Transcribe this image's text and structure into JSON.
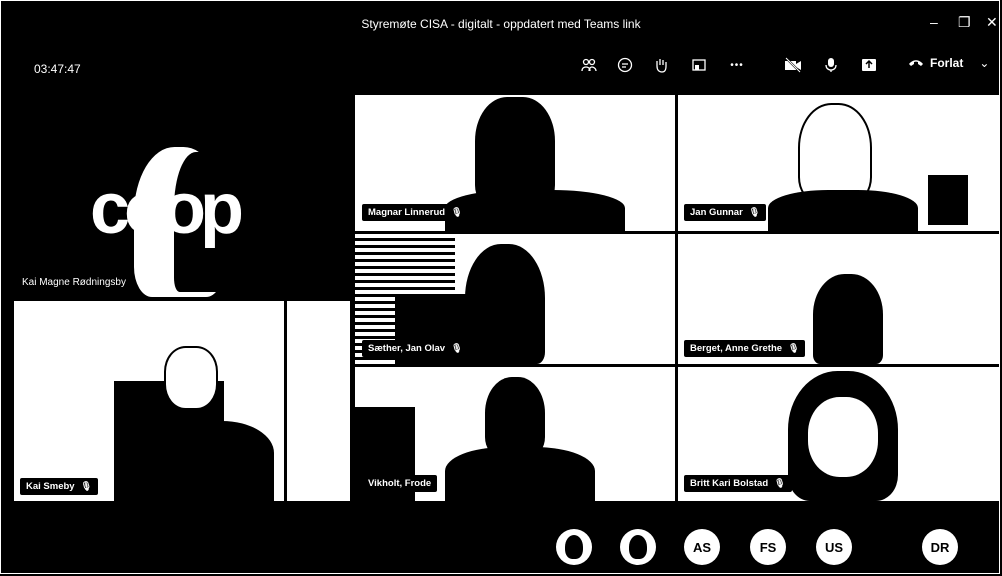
{
  "window": {
    "title": "Styremøte CISA - digitalt - oppdatert med Teams link",
    "minimize_glyph": "–",
    "restore_glyph": "❐",
    "close_glyph": "✕"
  },
  "meeting": {
    "timer": "03:47:47",
    "leave_label": "Forlat",
    "leave_chevron": "⌄",
    "more_glyph": "•••"
  },
  "spotlight": {
    "logo_text": "coop",
    "name": "Kai Magne Rødningsby"
  },
  "participants": [
    {
      "name": "Kai Smeby"
    },
    {
      "name": "Magnar Linnerud"
    },
    {
      "name": "Jan Gunnar"
    },
    {
      "name": "Sæther, Jan Olav"
    },
    {
      "name": "Berget, Anne Grethe"
    },
    {
      "name": "Vikholt, Frode"
    },
    {
      "name": "Britt Kari Bolstad"
    }
  ],
  "overflow": [
    {
      "initials": ""
    },
    {
      "initials": ""
    },
    {
      "initials": "AS"
    },
    {
      "initials": "FS"
    },
    {
      "initials": "US"
    },
    {
      "initials": "DR"
    }
  ],
  "icons": {
    "mic_muted": "🎙"
  }
}
